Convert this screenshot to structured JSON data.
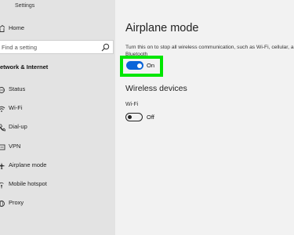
{
  "window": {
    "title": "Settings"
  },
  "sidebar": {
    "home_label": "Home",
    "search_placeholder": "Find a setting",
    "section_title": "etwork & Internet",
    "items": [
      {
        "label": "Status",
        "icon": "globe-icon"
      },
      {
        "label": "Wi-Fi",
        "icon": "wifi-icon"
      },
      {
        "label": "Dial-up",
        "icon": "phone-icon"
      },
      {
        "label": "VPN",
        "icon": "vpn-icon"
      },
      {
        "label": "Airplane mode",
        "icon": "airplane-icon"
      },
      {
        "label": "Mobile hotspot",
        "icon": "hotspot-icon"
      },
      {
        "label": "Proxy",
        "icon": "globe-icon"
      }
    ]
  },
  "content": {
    "title": "Airplane mode",
    "description": "Turn this on to stop all wireless communication, such as Wi-Fi, cellular, and Bluetooth",
    "airplane_toggle": {
      "state": "On",
      "on": true
    },
    "wireless_section_title": "Wireless devices",
    "wifi_label": "Wi-Fi",
    "wifi_toggle": {
      "state": "Off",
      "on": false
    }
  },
  "colors": {
    "accent": "#0a64d8",
    "highlight": "#00e600",
    "sidebar_bg": "#e3e3e3",
    "content_bg": "#f2f2f2"
  }
}
